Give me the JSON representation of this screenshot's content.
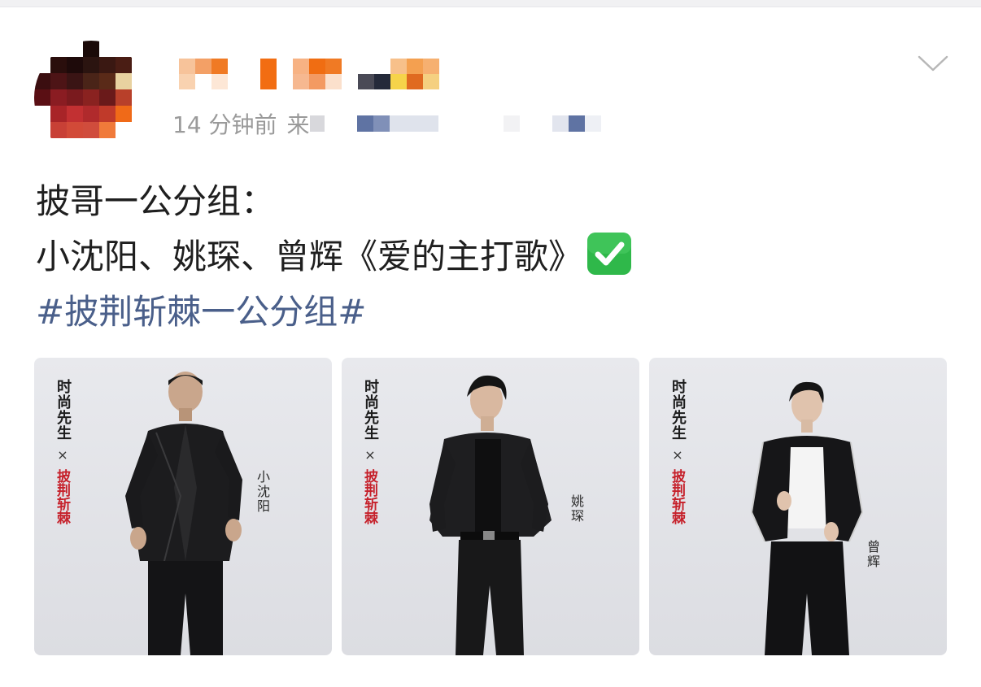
{
  "post": {
    "time": "14 分钟前",
    "source_partial": "来",
    "content": {
      "line1": "披哥一公分组：",
      "line2": "小沈阳、姚琛、曾辉《爱的主打歌》",
      "check_icon": "white-heavy-check-mark-emoji",
      "hashtag": "#披荆斩棘一公分组#"
    }
  },
  "images": [
    {
      "brand_top": "时尚先生",
      "brand_x": "×",
      "brand_bottom": "披荆斩棘",
      "person_label": "小沈阳",
      "outfit": "black-leather-jacket"
    },
    {
      "brand_top": "时尚先生",
      "brand_x": "×",
      "brand_bottom": "披荆斩棘",
      "person_label": "姚琛",
      "outfit": "black-leather-jacket-tank"
    },
    {
      "brand_top": "时尚先生",
      "brand_x": "×",
      "brand_bottom": "披荆斩棘",
      "person_label": "曾辉",
      "outfit": "black-cropped-jacket-white-shirt"
    }
  ],
  "colors": {
    "hashtag": "#4a5f8a",
    "meta_text": "#9a9a9a",
    "body_text": "#1f1f1f",
    "check_green": "#2fb84a",
    "brand_red": "#c6212b",
    "image_bg": "#e2e3e7"
  },
  "icons": {
    "more_menu": "chevron-down-icon"
  }
}
